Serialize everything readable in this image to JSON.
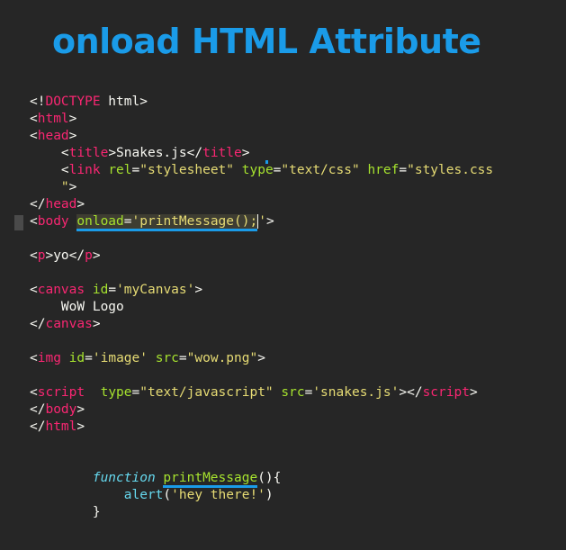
{
  "title": "onload HTML Attribute",
  "code": {
    "doctype": {
      "open": "<!",
      "keyword": "DOCTYPE",
      "rest": " html>"
    },
    "html_open": {
      "lt": "<",
      "tag": "html",
      "gt": ">"
    },
    "head_open": {
      "lt": "<",
      "tag": "head",
      "gt": ">"
    },
    "title_line": {
      "lt1": "<",
      "tag1": "title",
      "gt1": ">",
      "text": "Snakes.js",
      "lt2": "</",
      "tag2": "title",
      "gt2": ">"
    },
    "link_line": {
      "lt": "<",
      "tag": "link",
      "a1": "rel",
      "eq1": "=",
      "v1": "\"stylesheet\"",
      "a2": "type",
      "eq2": "=",
      "v2": "\"text/css\"",
      "a3": "href",
      "eq3": "=",
      "v3": "\"styles.css"
    },
    "link_cont": {
      "v": "\"",
      "gt": ">"
    },
    "head_close": {
      "lt": "</",
      "tag": "head",
      "gt": ">"
    },
    "body_line": {
      "lt": "<",
      "tag": "body",
      "attr": "onload",
      "eq": "=",
      "q1": "'",
      "fn": "printMessage",
      "paren": "();",
      "q2": "'",
      "gt": ">"
    },
    "p_line": {
      "lt1": "<",
      "tag1": "p",
      "gt1": ">",
      "text": "yo",
      "lt2": "</",
      "tag2": "p",
      "gt2": ">"
    },
    "canvas_open": {
      "lt": "<",
      "tag": "canvas",
      "attr": "id",
      "eq": "=",
      "val": "'myCanvas'",
      "gt": ">"
    },
    "canvas_text": "WoW Logo",
    "canvas_close": {
      "lt": "</",
      "tag": "canvas",
      "gt": ">"
    },
    "img_line": {
      "lt": "<",
      "tag": "img",
      "a1": "id",
      "eq1": "=",
      "v1": "'image'",
      "a2": "src",
      "eq2": "=",
      "v2": "\"wow.png\"",
      "gt": ">"
    },
    "script_line": {
      "lt": "<",
      "tag": "script",
      "a1": "type",
      "eq1": "=",
      "v1": "\"text/javascript\"",
      "a2": "src",
      "eq2": "=",
      "v2": "'snakes.js'",
      "gt1": ">",
      "lt2": "</",
      "tag2": "script",
      "gt2": ">"
    },
    "body_close": {
      "lt": "</",
      "tag": "body",
      "gt": ">"
    },
    "html_close": {
      "lt": "</",
      "tag": "html",
      "gt": ">"
    },
    "fn_decl": {
      "kw": "function",
      "name": "printMessage",
      "rest": "(){"
    },
    "fn_body": {
      "call": "alert",
      "open": "(",
      "str": "'hey there!'",
      "close": ")"
    },
    "fn_close": "}"
  }
}
